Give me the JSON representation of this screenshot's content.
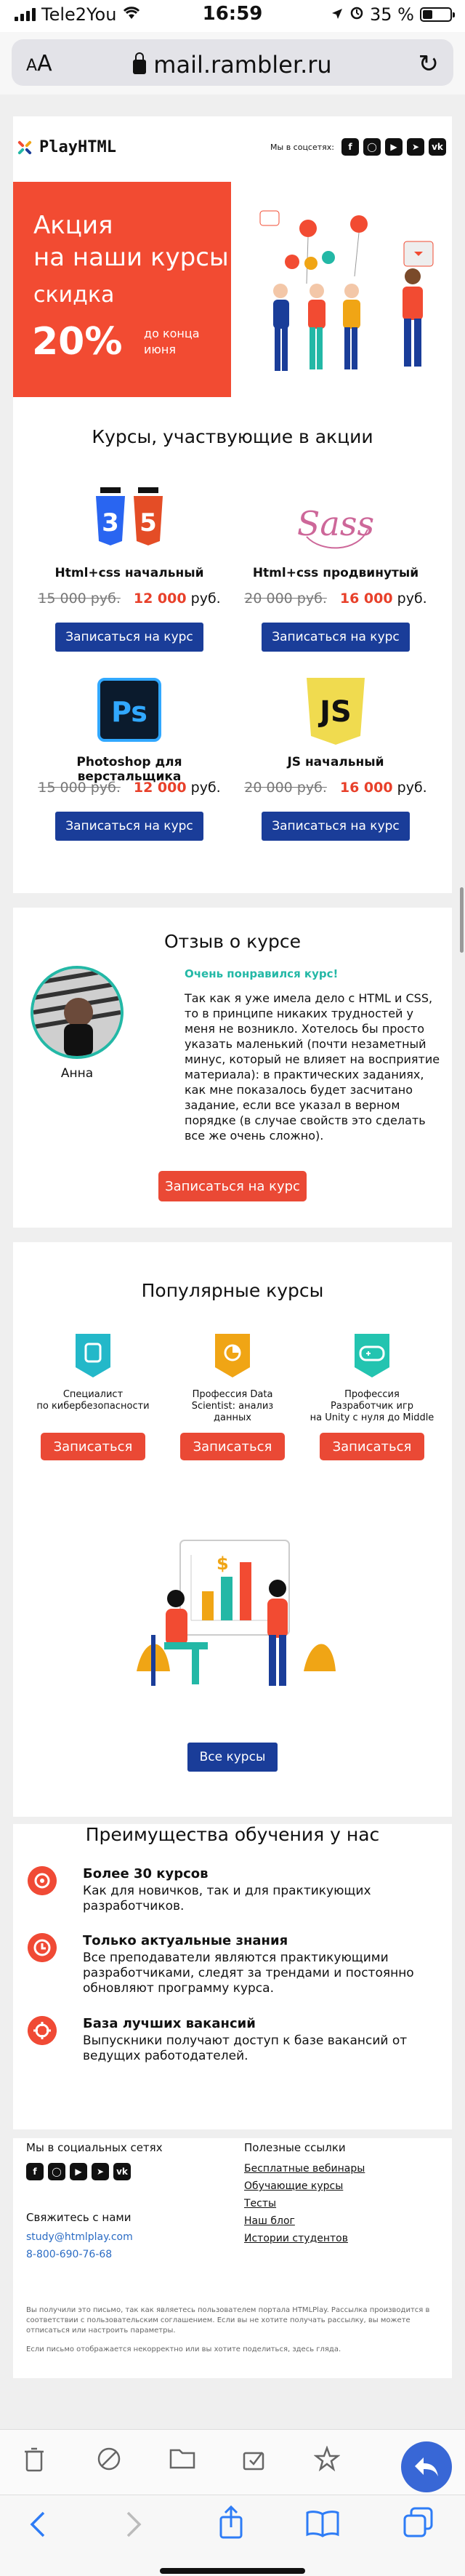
{
  "status": {
    "carrier": "Tele2You",
    "time": "16:59",
    "battery_pct": "35 %",
    "battery_level": 0.35
  },
  "browser": {
    "aa": "AA",
    "url": "mail.rambler.ru"
  },
  "header": {
    "logo": "PlayHTML",
    "social_caption": "Мы в соцсетях:",
    "social": [
      "f",
      "ig",
      "yt",
      "tg",
      "vk"
    ]
  },
  "banner": {
    "title_line1": "Акция",
    "title_line2": "на наши курсы",
    "subtitle": "скидка",
    "discount": "20%",
    "until_line1": "до конца",
    "until_line2": "июня"
  },
  "courses": {
    "title": "Курсы, участвующие в акции",
    "items": [
      {
        "name": "Html+css начальный",
        "old": "15 000 руб.",
        "new": "12 000",
        "unit": "руб.",
        "button": "Записаться на курс",
        "logo": "html-css-icon"
      },
      {
        "name": "Html+css продвинутый",
        "old": "20 000 руб.",
        "new": "16 000",
        "unit": "руб.",
        "button": "Записаться на курс",
        "logo": "sass-icon"
      },
      {
        "name": "Photoshop для верстальщика",
        "old": "15 000 руб.",
        "new": "12 000",
        "unit": "руб.",
        "button": "Записаться на курс",
        "logo": "photoshop-icon"
      },
      {
        "name": "JS начальный",
        "old": "20 000 руб.",
        "new": "16 000",
        "unit": "руб.",
        "button": "Записаться на курс",
        "logo": "js-icon"
      }
    ]
  },
  "review": {
    "title": "Отзыв о курсе",
    "author": "Анна",
    "lead": "Очень понравился курс!",
    "text": "Так как я уже имела дело с HTML и CSS, то в принципе никаких трудностей у меня не возникло. Хотелось бы просто указать маленький (почти незаметный минус, который не влияет на восприятие материала): в практических заданиях, как мне показалось будет засчитано задание, если все указал в верном порядке (в случае свойств это сделать все же очень сложно).",
    "button": "Записаться на курс"
  },
  "popular": {
    "title": "Популярные курсы",
    "items": [
      {
        "line1": "Специалист",
        "line2": "по кибербезопасности",
        "line3": "",
        "button": "Записаться",
        "color": "#23b8c9"
      },
      {
        "line1": "Профессия Data",
        "line2": "Scientist: анализ",
        "line3": "данных",
        "button": "Записаться",
        "color": "#f0a515"
      },
      {
        "line1": "Профессия",
        "line2": "Разработчик игр",
        "line3": "на Unity с нуля до Middle",
        "button": "Записаться",
        "color": "#23c4b0"
      }
    ],
    "all_button": "Все курсы"
  },
  "advantages": {
    "title": "Преимущества обучения у нас",
    "items": [
      {
        "title": "Более 30 курсов",
        "desc": "Как для новичков, так и для практикующих разработчиков."
      },
      {
        "title": "Только актуальные знания",
        "desc": "Все преподаватели являются практикующими разработчиками, следят за трендами и постоянно обновляют программу курса."
      },
      {
        "title": "База лучших вакансий",
        "desc": "Выпускники получают доступ к базе вакансий от ведущих работодателей."
      }
    ]
  },
  "footer": {
    "social_title": "Мы в социальных сетях",
    "contact_title": "Свяжитесь с нами",
    "email": "study@htmlplay.com",
    "phone": "8-800-690-76-68",
    "links_title": "Полезные ссылки",
    "links": [
      "Бесплатные вебинары",
      "Обучающие курсы",
      "Тесты",
      "Наш блог",
      "Истории студентов"
    ],
    "note1": "Вы получили это письмо, так как являетесь пользователем портала HTMLPlay. Рассылка производится в соответствии с пользовательским соглашением. Если вы не хотите получать рассылку, вы можете отписаться или настроить параметры.",
    "note2": "Если письмо отображается некорректно или вы хотите поделиться, здесь гляда."
  },
  "colors": {
    "accent_red": "#f24b32",
    "accent_blue": "#1a3d99",
    "accent_green": "#23b8a6"
  }
}
